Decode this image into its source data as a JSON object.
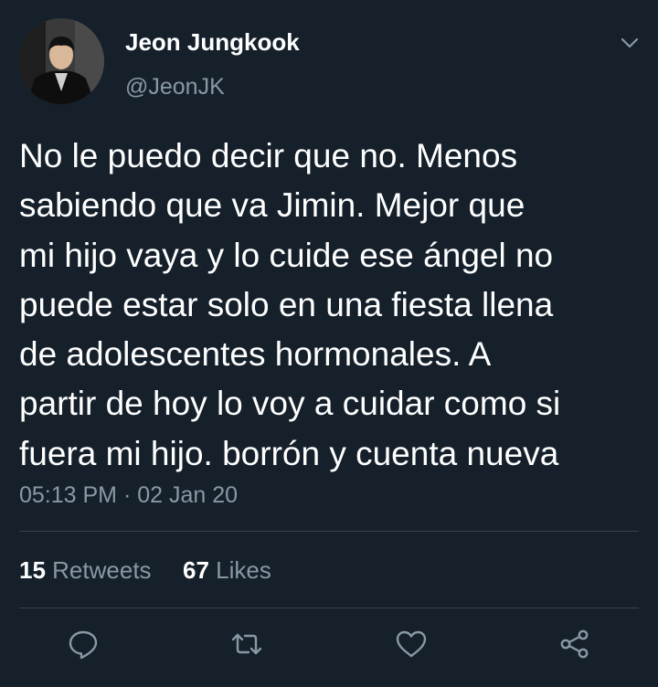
{
  "author": {
    "display_name": "Jeon Jungkook",
    "handle": "@JeonJK"
  },
  "tweet": {
    "lines": [
      "No le puedo decir que no. Menos",
      "sabiendo que va Jimin. Mejor que",
      "mi hijo vaya y lo cuide ese ángel no",
      "puede estar solo en una fiesta llena",
      "de adolescentes hormonales. A",
      "partir de hoy lo voy a cuidar como si",
      "fuera mi hijo. borrón y cuenta nueva"
    ],
    "timestamp": "05:13 PM · 02 Jan 20"
  },
  "stats": {
    "retweets_count": "15",
    "retweets_label": "Retweets",
    "likes_count": "67",
    "likes_label": "Likes"
  },
  "actions": [
    "reply-icon",
    "retweet-icon",
    "like-icon",
    "share-icon"
  ],
  "colors": {
    "background": "#15202b",
    "text_primary": "#ffffff",
    "text_secondary": "#8899a6",
    "divider": "#38444d"
  }
}
